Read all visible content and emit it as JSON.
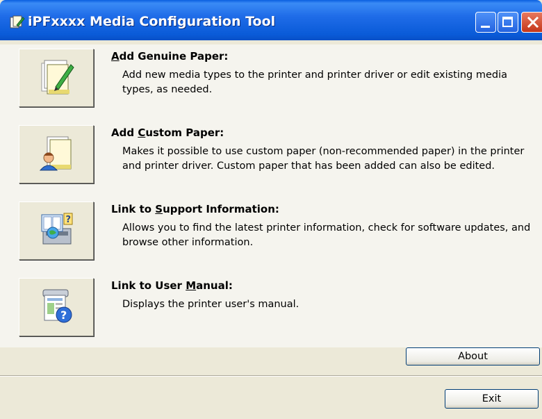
{
  "window": {
    "title": "iPFxxxx  Media Configuration Tool",
    "controls": [
      "minimize",
      "maximize",
      "close"
    ]
  },
  "items": [
    {
      "title_pre": "",
      "title_key": "A",
      "title_post": "dd Genuine Paper:",
      "description": "Add new media types to the printer and printer driver or edit existing media types, as needed.",
      "icon": "paper-edit-icon"
    },
    {
      "title_pre": "Add ",
      "title_key": "C",
      "title_post": "ustom Paper:",
      "description": "Makes it possible to use custom paper (non-recommended paper) in the printer and printer driver. Custom paper that has been added can also be edited.",
      "icon": "custom-paper-user-icon"
    },
    {
      "title_pre": "Link to ",
      "title_key": "S",
      "title_post": "upport Information:",
      "description": "Allows you to find the latest printer information, check for software updates, and browse other information.",
      "icon": "support-info-icon"
    },
    {
      "title_pre": "Link to User ",
      "title_key": "M",
      "title_post": "anual:",
      "description": "Displays the printer user's manual.",
      "icon": "user-manual-help-icon"
    }
  ],
  "buttons": {
    "about": "About",
    "exit": "Exit"
  }
}
